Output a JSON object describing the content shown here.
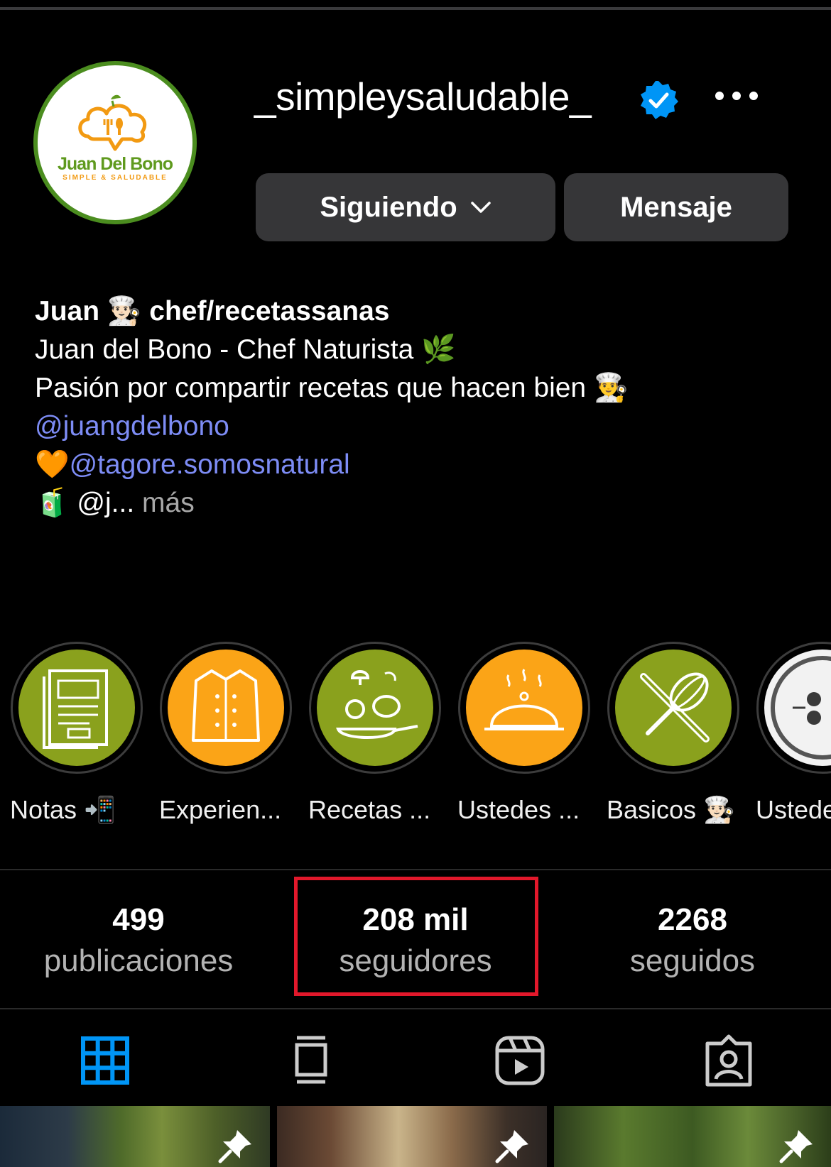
{
  "profile": {
    "username": "_simpleysaludable_",
    "avatar": {
      "logo_name": "Juan Del Bono",
      "logo_tagline": "SIMPLE & SALUDABLE"
    },
    "follow_button": "Siguiendo",
    "message_button": "Mensaje"
  },
  "bio": {
    "name_line": "Juan 👨🏻‍🍳 chef/recetassanas",
    "line2": "Juan del Bono - Chef Naturista 🌿",
    "line3": "Pasión por compartir recetas que hacen bien 👨‍🍳",
    "mention1": "@juangdelbono",
    "heart": "🧡",
    "mention2": "@tagore.somosnatural",
    "juice": "🧃",
    "truncated": "@j...",
    "more": "más"
  },
  "highlights": [
    {
      "label": "Notas 📲",
      "color": "#8aa11d",
      "icon": "notebook-icon"
    },
    {
      "label": "Experien...",
      "color": "#fba417",
      "icon": "chef-jacket-icon"
    },
    {
      "label": "Recetas ...",
      "color": "#8aa11d",
      "icon": "cooking-pan-icon"
    },
    {
      "label": "Ustedes ...",
      "color": "#fba417",
      "icon": "cloche-icon"
    },
    {
      "label": "Basicos 👨🏻‍🍳",
      "color": "#8aa11d",
      "icon": "whisk-rolling-pin-icon"
    },
    {
      "label": "Ustede",
      "color": "#f2f2f2",
      "icon": "pans-icon"
    }
  ],
  "stats": {
    "posts": {
      "value": "499",
      "label": "publicaciones"
    },
    "followers": {
      "value": "208 mil",
      "label": "seguidores"
    },
    "following": {
      "value": "2268",
      "label": "seguidos"
    }
  },
  "tabs": [
    {
      "name": "grid-tab",
      "icon": "grid-icon",
      "active": true
    },
    {
      "name": "feed-tab",
      "icon": "feed-icon",
      "active": false
    },
    {
      "name": "reels-tab",
      "icon": "reels-icon",
      "active": false
    },
    {
      "name": "tagged-tab",
      "icon": "tagged-icon",
      "active": false
    }
  ],
  "colors": {
    "accent": "#0095f6",
    "link": "#7d8cf5",
    "highlight_box": "#e2182b",
    "verified": "#0095f6"
  }
}
